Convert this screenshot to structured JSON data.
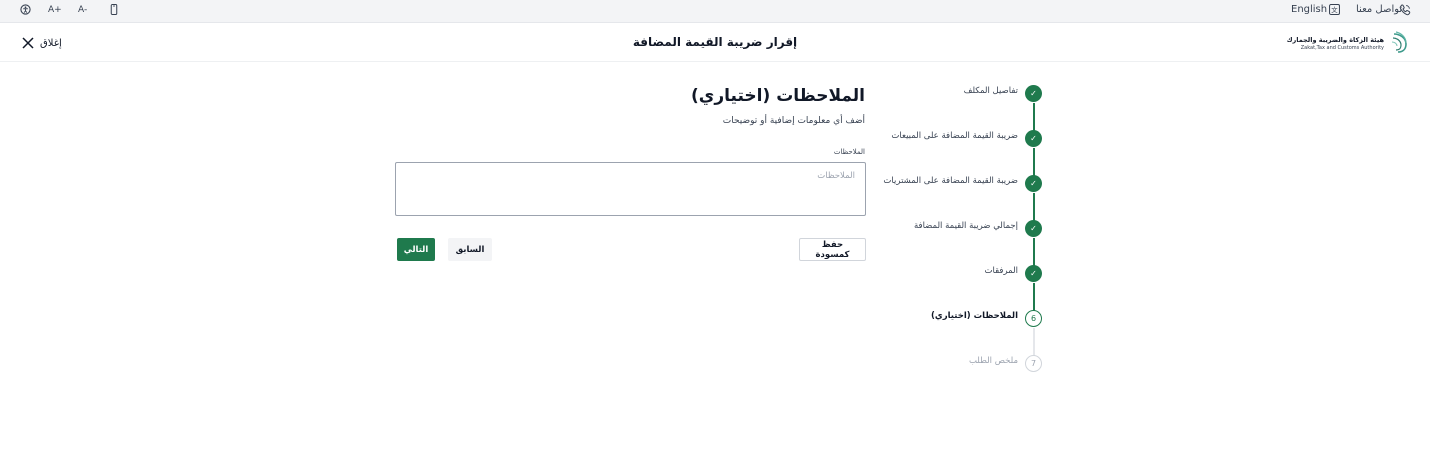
{
  "topbar": {
    "contact_label": "تواصل معنا",
    "language_label": "English",
    "font_increase_label": "A+",
    "font_decrease_label": "A-"
  },
  "header": {
    "title": "إقرار ضريبة القيمة المضافة",
    "close_label": "إغلاق",
    "logo_ar": "هيئة الزكاة والضريبة والجمارك",
    "logo_en": "Zakat,Tax and Customs Authority"
  },
  "stepper": {
    "steps": [
      {
        "label": "تفاصيل المكلف",
        "state": "done"
      },
      {
        "label": "ضريبة القيمة المضافة على المبيعات",
        "state": "done"
      },
      {
        "label": "ضريبة القيمة المضافة على المشتريات",
        "state": "done"
      },
      {
        "label": "إجمالي ضريبة القيمة المضافة",
        "state": "done"
      },
      {
        "label": "المرفقات",
        "state": "done"
      },
      {
        "label": "الملاحظات (اختياري)",
        "state": "current",
        "number": "6"
      },
      {
        "label": "ملخص الطلب",
        "state": "upcoming",
        "number": "7"
      }
    ]
  },
  "form": {
    "title": "الملاحظات (اختياري)",
    "subtitle": "أضف أي معلومات إضافية أو توضيحات",
    "notes_label": "الملاحظات",
    "notes_placeholder": "الملاحظات",
    "notes_value": ""
  },
  "actions": {
    "save_draft_label": "حفظ كمسودة",
    "previous_label": "السابق",
    "next_label": "التالي"
  },
  "colors": {
    "primary": "#1f7a4d",
    "grey_line": "#e5e7eb"
  }
}
